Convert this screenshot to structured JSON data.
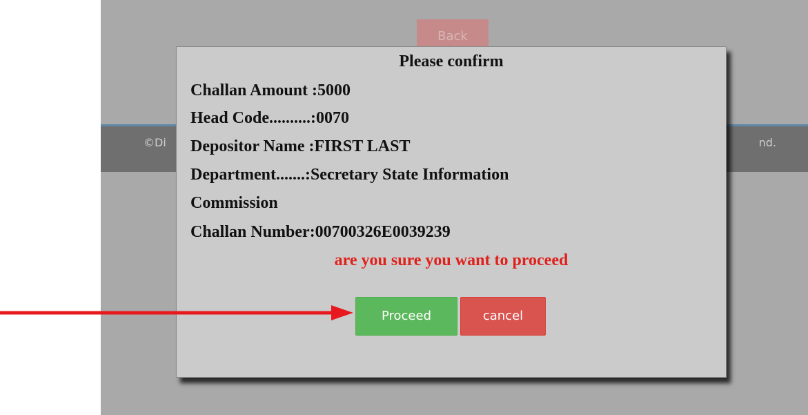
{
  "background": {
    "back_button_label": "Back",
    "footer_left_text": "©Di",
    "footer_right_text": "nd."
  },
  "dialog": {
    "title": "Please confirm",
    "lines": [
      "Challan Amount :5000",
      "Head Code..........:0070",
      "Depositor Name :FIRST LAST",
      "Department.......:Secretary State Information",
      "Commission",
      "Challan Number:00700326E0039239"
    ],
    "warning": "are you sure you want to proceed",
    "proceed_label": "Proceed",
    "cancel_label": "cancel"
  },
  "colors": {
    "proceed": "#5cb85c",
    "cancel": "#d9534f",
    "warning_text": "#e0201a",
    "annotation_arrow": "#e8191e"
  },
  "icons": {
    "annotation": "right-arrow-icon"
  }
}
